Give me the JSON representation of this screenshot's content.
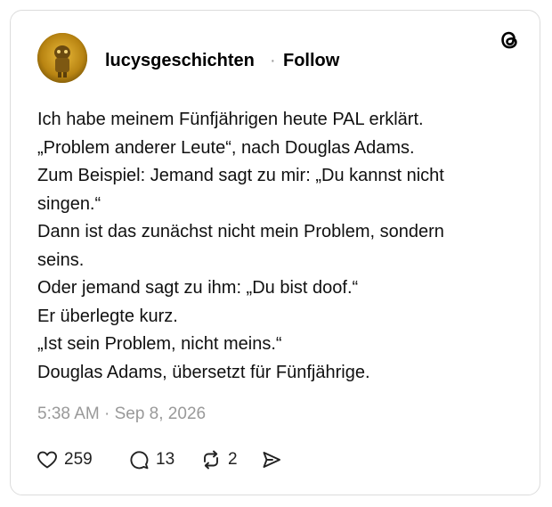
{
  "post": {
    "author": {
      "username": "lucysgeschichten",
      "separator": "·",
      "follow_label": "Follow",
      "avatar": "avatar-image"
    },
    "brand_icon": "threads-logo-icon",
    "lines": [
      "Ich habe meinem Fünfjährigen heute PAL erklärt.",
      "„Problem anderer Leute“, nach Douglas Adams.",
      "Zum Beispiel: Jemand sagt zu mir: „Du kannst nicht",
      "singen.“",
      "Dann ist das zunächst nicht mein Problem, sondern",
      "seins.",
      "Oder jemand sagt zu ihm: „Du bist doof.“",
      "Er überlegte kurz.",
      "„Ist sein Problem, nicht meins.“",
      "Douglas Adams, übersetzt für Fünfjährige."
    ],
    "timestamp": "5:38 AM · Sep 8, 2026",
    "stats": {
      "likes": {
        "icon": "heart-icon",
        "count": "259"
      },
      "replies": {
        "icon": "comment-icon",
        "count": "13"
      },
      "reposts": {
        "icon": "repost-icon",
        "count": "2"
      },
      "share": {
        "icon": "share-icon"
      }
    }
  }
}
